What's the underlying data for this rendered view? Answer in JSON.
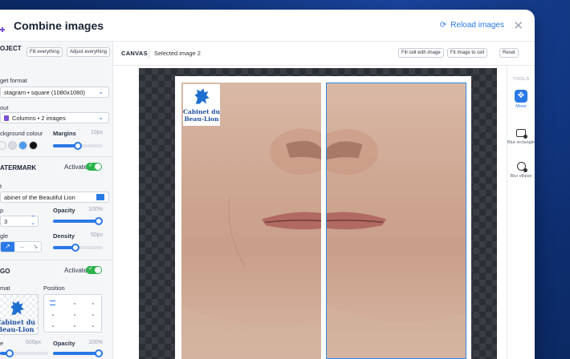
{
  "window": {
    "title": "Combine images",
    "reload_label": "Reload images",
    "close_glyph": "✕"
  },
  "project": {
    "heading": "OJECT",
    "fill_everything": "Fill everything",
    "adjust_everything": "Adjust everything",
    "target_format_label": "get format",
    "target_format_value": "stagram • square (1080x1080)",
    "layout_label": "out",
    "layout_value": "Columns • 2 images",
    "bg_colour_label": "ckground colour",
    "margins_label": "Margins",
    "margins_value": "10px",
    "margins_level": 0.5,
    "swatches": [
      "#f2f3f5",
      "#d9dde3",
      "#4a9cf2",
      "#111111"
    ]
  },
  "watermark": {
    "heading": "ATERMARK",
    "activate_label": "Activate",
    "text_label": "t",
    "text_value": "abinet of the Beautiful Lion",
    "size_label": "p",
    "size_value": "3",
    "opacity_label": "Opacity",
    "opacity_value": "100%",
    "opacity_level": 1.0,
    "angle_label": "gle",
    "density_label": "Density",
    "density_value": "50px",
    "density_level": 0.45
  },
  "logo": {
    "heading": "GO",
    "activate_label": "Activate",
    "format_label": "mat",
    "position_label": "Position",
    "logo_text_1": "Cabinet du",
    "logo_text_2": "Beau-Lion",
    "size_label": "e",
    "size_value": "500px",
    "size_level": 0.2,
    "opacity_label": "Opacity",
    "opacity_value": "100%",
    "opacity_level": 1.0
  },
  "canvas": {
    "label": "CANVAS",
    "selected": "Selected image 2",
    "fill_cell": "Fill cell with image",
    "fit_cell": "Fit image to cell",
    "reset": "Reset",
    "watermark_text_1": "Cabinet du",
    "watermark_text_2": "Beau-Lion"
  },
  "tools": {
    "title": "TOOLS",
    "move": "Move",
    "blur_rect": "Blur rectangle",
    "blur_ellipse": "Blur ellipse"
  },
  "colors": {
    "accent": "#2a79e6",
    "toggle": "#2bb24c",
    "background": "#0d2d6e"
  }
}
